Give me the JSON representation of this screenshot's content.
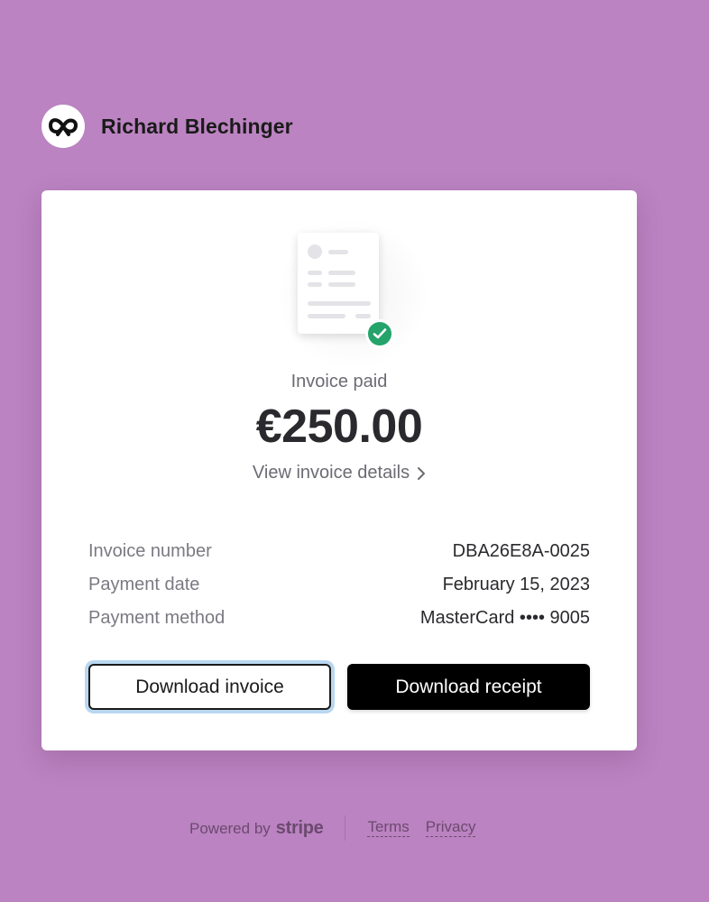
{
  "merchant": {
    "name": "Richard Blechinger",
    "logo_icon": "pretzel-icon"
  },
  "invoice": {
    "status_label": "Invoice paid",
    "amount": "€250.00",
    "view_details_label": "View invoice details",
    "details": [
      {
        "label": "Invoice number",
        "value": "DBA26E8A-0025"
      },
      {
        "label": "Payment date",
        "value": "February 15, 2023"
      },
      {
        "label": "Payment method",
        "value": "MasterCard •••• 9005"
      }
    ],
    "status_icon": "check-circle-icon",
    "status_color": "#24a36b"
  },
  "actions": {
    "download_invoice_label": "Download invoice",
    "download_receipt_label": "Download receipt"
  },
  "footer": {
    "powered_by": "Powered by",
    "brand": "stripe",
    "terms_label": "Terms",
    "privacy_label": "Privacy"
  },
  "colors": {
    "background": "#bb83c1",
    "card": "#ffffff",
    "primary_button": "#000000",
    "focus_ring": "#b9d7f0"
  }
}
